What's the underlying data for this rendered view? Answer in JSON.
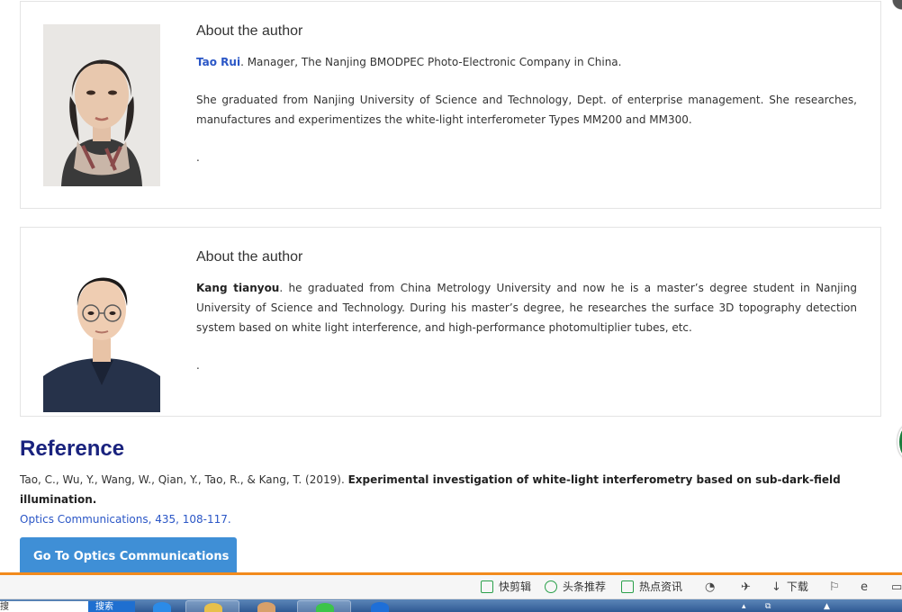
{
  "authors": [
    {
      "section_title": "About the author",
      "name": "Tao Rui",
      "intro": ". Manager, The Nanjing BMODPEC Photo-Electronic Company in China.",
      "bio": "She graduated from Nanjing University of Science and Technology, Dept. of enterprise management. She researches, manufactures and experimentizes the white-light interferometer Types MM200 and MM300.",
      "trailing": "."
    },
    {
      "section_title": "About the author",
      "name": "Kang tianyou",
      "intro": ". he graduated from China Metrology University and now he is a master’s degree student in Nanjing University of Science and Technology. During his master’s degree, he researches the surface 3D topography detection system based on white light interference, and high-performance photomultiplier tubes, etc.",
      "trailing": "."
    }
  ],
  "reference": {
    "heading": "Reference",
    "citation_authors": "Tao, C., Wu, Y., Wang, W., Qian, Y., Tao, R., & Kang, T. (2019). ",
    "citation_title": "Experimental investigation of white-light interferometry based on sub-dark-field illumination.",
    "journal_link": "Optics Communications, 435, 108-117",
    "journal_suffix": ".",
    "button_label": "Go To Optics Communications"
  },
  "status_bar": {
    "items": [
      {
        "label": "快剪辑",
        "icon": "play-icon"
      },
      {
        "label": "头条推荐",
        "icon": "circle-play-icon"
      },
      {
        "label": "热点资讯",
        "icon": "news-icon"
      },
      {
        "label": "下载",
        "icon": "download-icon"
      }
    ]
  },
  "taskbar": {
    "search_text": "搜",
    "search_button": "搜索"
  }
}
